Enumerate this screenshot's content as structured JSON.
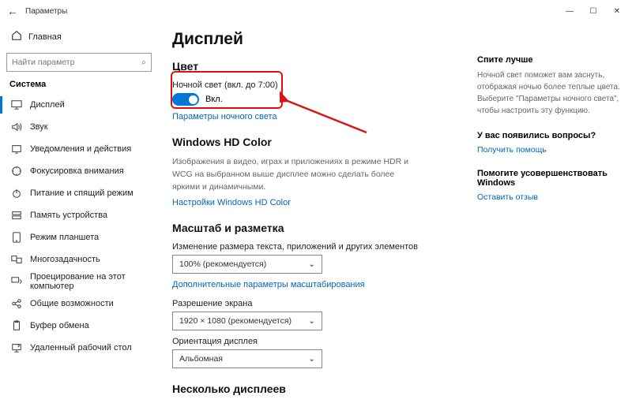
{
  "window": {
    "title": "Параметры",
    "min": "—",
    "max": "☐",
    "close": "✕"
  },
  "sidebar": {
    "home": "Главная",
    "search_placeholder": "Найти параметр",
    "group": "Система",
    "items": [
      {
        "icon": "display",
        "label": "Дисплей"
      },
      {
        "icon": "sound",
        "label": "Звук"
      },
      {
        "icon": "notify",
        "label": "Уведомления и действия"
      },
      {
        "icon": "focus",
        "label": "Фокусировка внимания"
      },
      {
        "icon": "power",
        "label": "Питание и спящий режим"
      },
      {
        "icon": "storage",
        "label": "Память устройства"
      },
      {
        "icon": "tablet",
        "label": "Режим планшета"
      },
      {
        "icon": "multi",
        "label": "Многозадачность"
      },
      {
        "icon": "project",
        "label": "Проецирование на этот компьютер"
      },
      {
        "icon": "shared",
        "label": "Общие возможности"
      },
      {
        "icon": "clip",
        "label": "Буфер обмена"
      },
      {
        "icon": "remote",
        "label": "Удаленный рабочий стол"
      }
    ]
  },
  "main": {
    "title": "Дисплей",
    "color": {
      "heading": "Цвет",
      "night_label": "Ночной свет (вкл. до 7:00)",
      "toggle_state": "Вкл.",
      "link": "Параметры ночного света"
    },
    "hd": {
      "heading": "Windows HD Color",
      "desc": "Изображения в видео, играх и приложениях в режиме HDR и WCG на выбранном выше дисплее можно сделать более яркими и динамичными.",
      "link": "Настройки Windows HD Color"
    },
    "scale": {
      "heading": "Масштаб и разметка",
      "size_label": "Изменение размера текста, приложений и других элементов",
      "size_value": "100% (рекомендуется)",
      "link": "Дополнительные параметры масштабирования",
      "res_label": "Разрешение экрана",
      "res_value": "1920 × 1080 (рекомендуется)",
      "orient_label": "Ориентация дисплея",
      "orient_value": "Альбомная"
    },
    "multi_heading": "Несколько дисплеев"
  },
  "aside": {
    "sleep_title": "Спите лучше",
    "sleep_desc": "Ночной свет поможет вам заснуть, отображая ночью более теплые цвета. Выберите \"Параметры ночного света\", чтобы настроить эту функцию.",
    "q_title": "У вас появились вопросы?",
    "q_link": "Получить помощь",
    "fb_title": "Помогите усовершенствовать Windows",
    "fb_link": "Оставить отзыв"
  }
}
